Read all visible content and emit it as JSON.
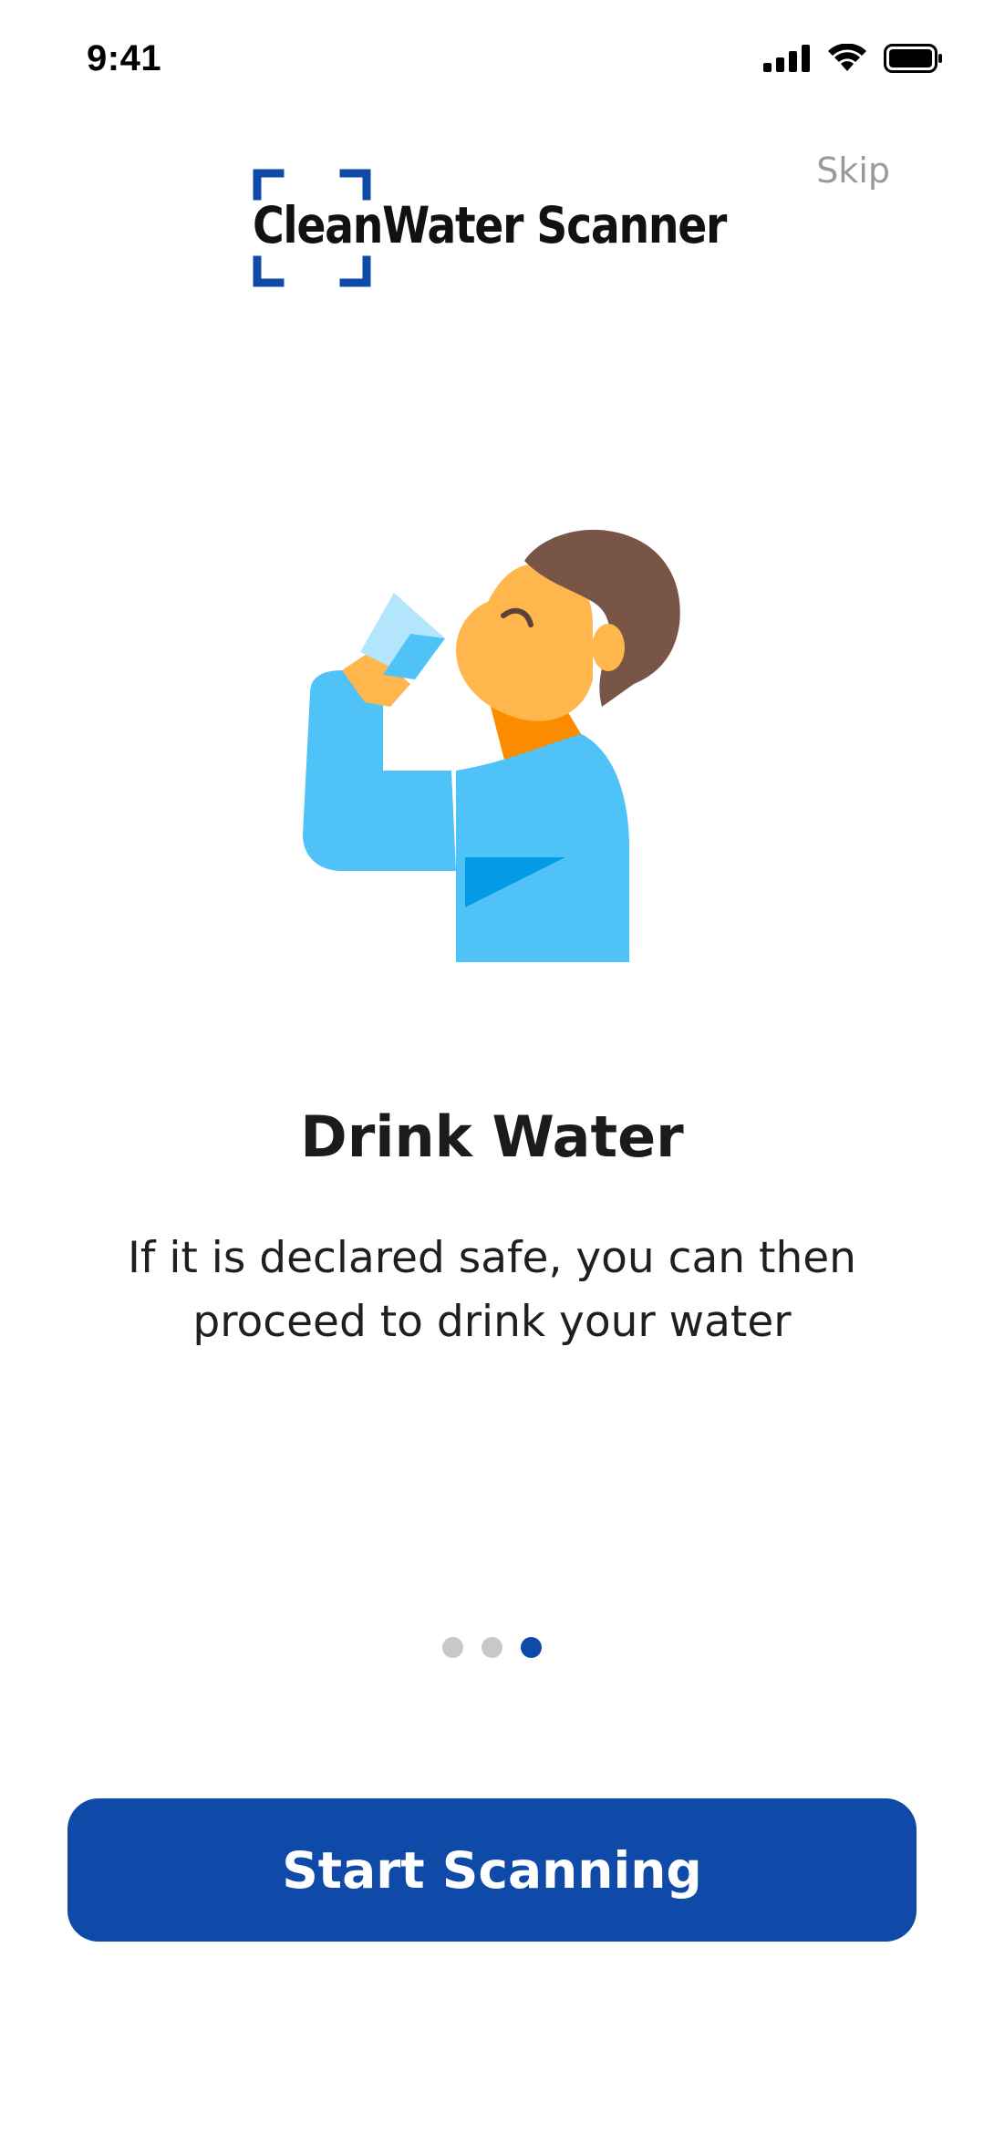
{
  "status_bar": {
    "time": "9:41",
    "icons": [
      "signal-icon",
      "wifi-icon",
      "battery-icon"
    ]
  },
  "header": {
    "skip_label": "Skip",
    "logo_text": "CleanWater Scanner"
  },
  "slide": {
    "illustration": "person-drinking-water",
    "title": "Drink Water",
    "description": "If it is declared safe, you can then proceed to drink your water"
  },
  "pager": {
    "total_pages": 3,
    "current_page": 3
  },
  "cta": {
    "label": "Start Scanning"
  },
  "colors": {
    "primary": "#0f4aa8",
    "dot_inactive": "#c8c8c8",
    "skip_text": "#9a9a9a",
    "shirt": "#4fc3f7",
    "skin": "#ffb74d",
    "hair": "#795548"
  }
}
